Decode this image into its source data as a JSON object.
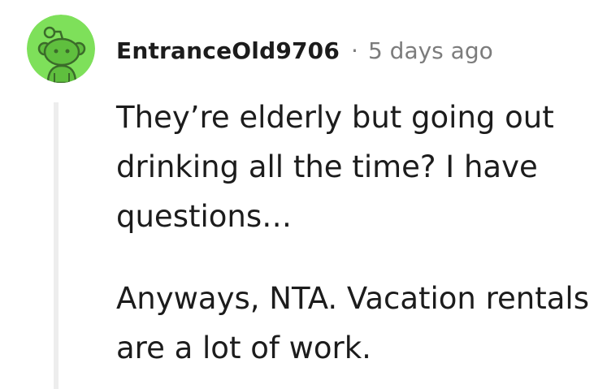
{
  "comment": {
    "username": "EntranceOld9706",
    "separator": "·",
    "timestamp": "5 days ago",
    "avatar_icon": "reddit-snoo-avatar-icon",
    "avatar_color": "#7ee05a",
    "paragraphs": [
      "They’re elderly but going out drinking all the time? I have questions…",
      "Anyways, NTA. Vacation rentals are a lot of work."
    ]
  }
}
